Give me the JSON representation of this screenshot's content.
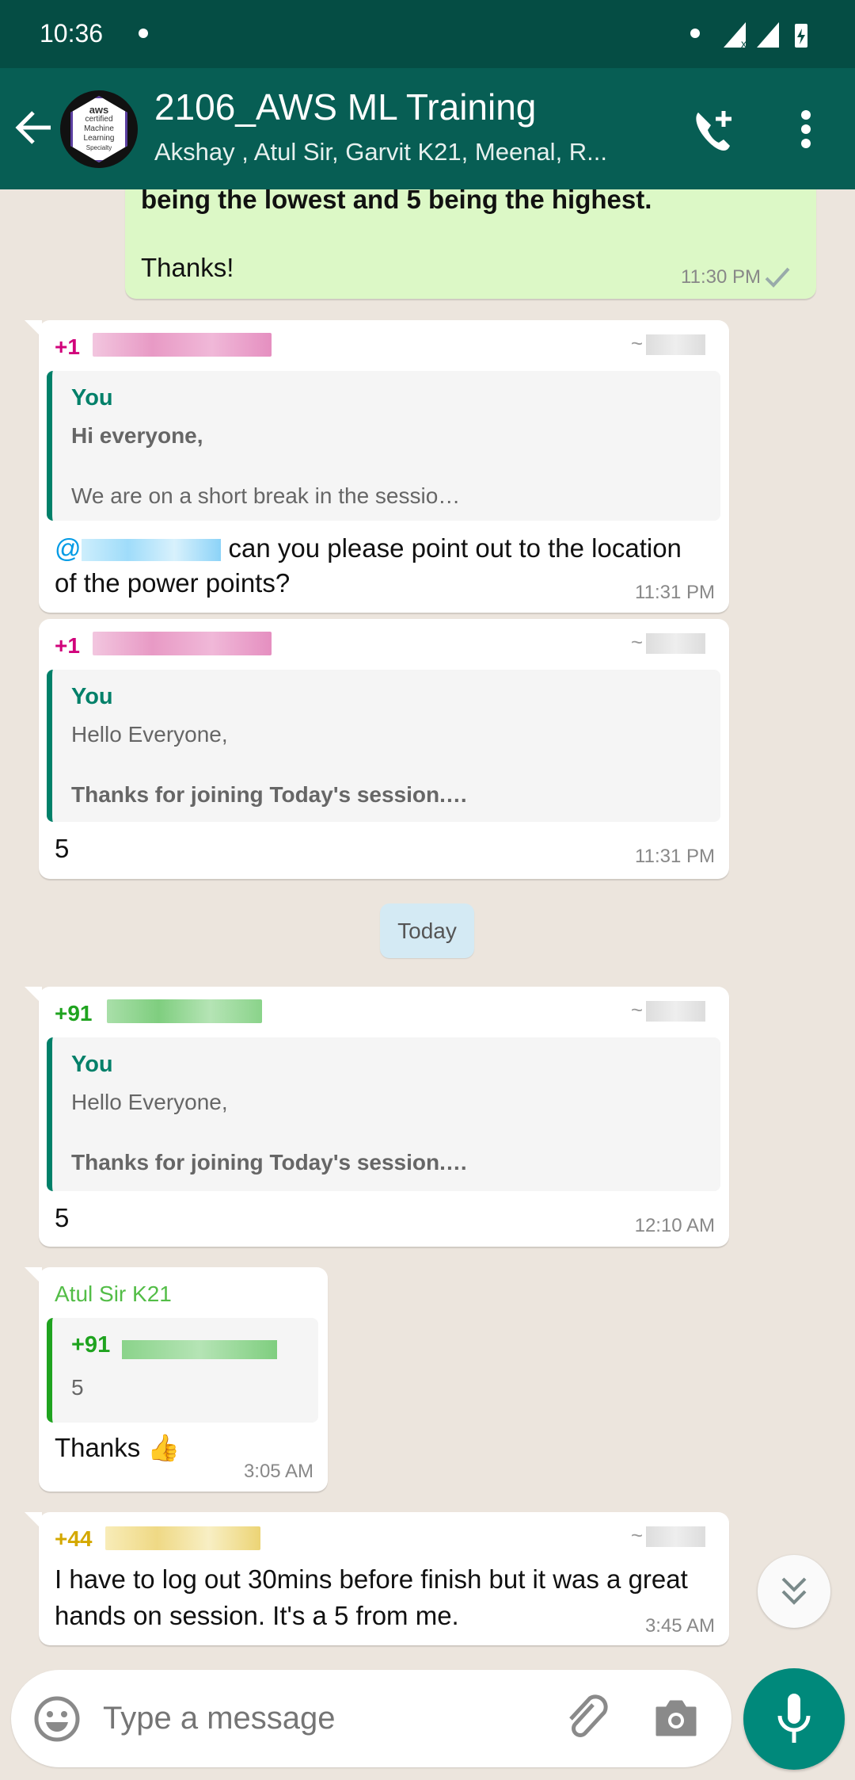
{
  "status_bar": {
    "time": "10:36"
  },
  "header": {
    "title": "2106_AWS ML Training",
    "subtitle": "Akshay , Atul Sir, Garvit K21, Meenal, R...",
    "avatar_text": [
      "aws",
      "certified",
      "Machine",
      "Learning",
      "Specialty"
    ]
  },
  "messages": [
    {
      "type": "outgoing",
      "text_line": "being the lowest and 5 being the highest.",
      "text_end": "Thanks!",
      "time": "11:30 PM",
      "status": "sent"
    },
    {
      "type": "incoming",
      "sender": "+1",
      "sender_color": "#d1037b",
      "quote": {
        "name": "You",
        "line1": "Hi everyone,",
        "line2": "We are on a short break in the sessio…"
      },
      "mention": "@",
      "text": "can you please point out to the location of the power points?",
      "time": "11:31 PM"
    },
    {
      "type": "incoming",
      "sender": "+1",
      "sender_color": "#d1037b",
      "quote": {
        "name": "You",
        "line1": "Hello Everyone,",
        "line2": "Thanks for joining Today's session.…"
      },
      "text": "5",
      "time": "11:31 PM"
    },
    {
      "type": "incoming",
      "sender": "+91",
      "sender_color": "#1fa31f",
      "quote": {
        "name": "You",
        "line1": "Hello Everyone,",
        "line2": "Thanks for joining Today's session.…"
      },
      "text": "5",
      "time": "12:10 AM"
    },
    {
      "type": "incoming",
      "sender": "Atul Sir K21",
      "sender_color": "#53bd47",
      "quote": {
        "name": "+91",
        "line1": "5"
      },
      "text": "Thanks 👍",
      "time": "3:05 AM"
    },
    {
      "type": "incoming",
      "sender": "+44",
      "sender_color": "#d4a800",
      "text": "I have to log out 30mins before finish but it was a great hands on session. It's a 5 from me.",
      "time": "3:45 AM"
    }
  ],
  "date_chip": "Today",
  "composer": {
    "placeholder": "Type a message"
  },
  "colors": {
    "header": "#075e54",
    "status_bar": "#054d44",
    "accent": "#008069",
    "outgoing": "#dcf8c6"
  }
}
